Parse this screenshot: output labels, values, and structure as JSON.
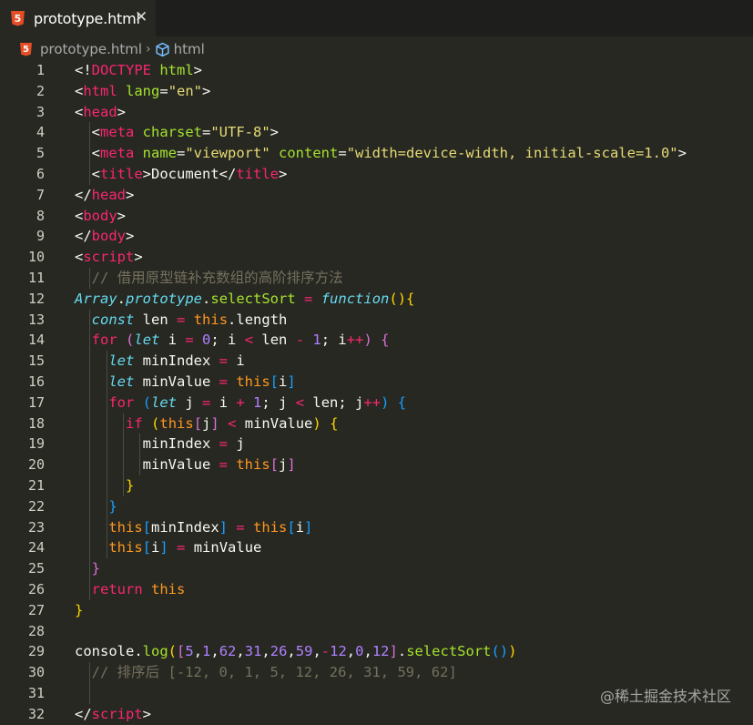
{
  "tab": {
    "file_icon": "html5-icon",
    "label": "prototype.html",
    "close_icon": "close-icon",
    "close_glyph": "✕"
  },
  "breadcrumb": {
    "file_icon": "html5-icon",
    "file": "prototype.html",
    "separator": "›",
    "symbol_icon": "cube-icon",
    "symbol": "html"
  },
  "editor": {
    "lines": [
      [
        {
          "t": "<!",
          "c": "p"
        },
        {
          "t": "DOCTYPE",
          "c": "k"
        },
        {
          "t": " ",
          "c": "p"
        },
        {
          "t": "html",
          "c": "a"
        },
        {
          "t": ">",
          "c": "p"
        }
      ],
      [
        {
          "t": "<",
          "c": "p"
        },
        {
          "t": "html",
          "c": "k"
        },
        {
          "t": " ",
          "c": "p"
        },
        {
          "t": "lang",
          "c": "a"
        },
        {
          "t": "=",
          "c": "p"
        },
        {
          "t": "\"en\"",
          "c": "s"
        },
        {
          "t": ">",
          "c": "p"
        }
      ],
      [
        {
          "t": "<",
          "c": "p"
        },
        {
          "t": "head",
          "c": "k"
        },
        {
          "t": ">",
          "c": "p"
        }
      ],
      [
        {
          "t": "  <",
          "c": "p"
        },
        {
          "t": "meta",
          "c": "k"
        },
        {
          "t": " ",
          "c": "p"
        },
        {
          "t": "charset",
          "c": "a"
        },
        {
          "t": "=",
          "c": "p"
        },
        {
          "t": "\"UTF-8\"",
          "c": "s"
        },
        {
          "t": ">",
          "c": "p"
        }
      ],
      [
        {
          "t": "  <",
          "c": "p"
        },
        {
          "t": "meta",
          "c": "k"
        },
        {
          "t": " ",
          "c": "p"
        },
        {
          "t": "name",
          "c": "a"
        },
        {
          "t": "=",
          "c": "p"
        },
        {
          "t": "\"viewport\"",
          "c": "s"
        },
        {
          "t": " ",
          "c": "p"
        },
        {
          "t": "content",
          "c": "a"
        },
        {
          "t": "=",
          "c": "p"
        },
        {
          "t": "\"width=device-width, initial-scale=1.0\"",
          "c": "s"
        },
        {
          "t": ">",
          "c": "p"
        }
      ],
      [
        {
          "t": "  <",
          "c": "p"
        },
        {
          "t": "title",
          "c": "k"
        },
        {
          "t": ">Document</",
          "c": "p"
        },
        {
          "t": "title",
          "c": "k"
        },
        {
          "t": ">",
          "c": "p"
        }
      ],
      [
        {
          "t": "</",
          "c": "p"
        },
        {
          "t": "head",
          "c": "k"
        },
        {
          "t": ">",
          "c": "p"
        }
      ],
      [
        {
          "t": "<",
          "c": "p"
        },
        {
          "t": "body",
          "c": "k"
        },
        {
          "t": ">",
          "c": "p"
        }
      ],
      [
        {
          "t": "</",
          "c": "p"
        },
        {
          "t": "body",
          "c": "k"
        },
        {
          "t": ">",
          "c": "p"
        }
      ],
      [
        {
          "t": "<",
          "c": "p"
        },
        {
          "t": "script",
          "c": "k"
        },
        {
          "t": ">",
          "c": "p"
        }
      ],
      [
        {
          "t": "  // 借用原型链补充数组的高阶排序方法",
          "c": "c"
        }
      ],
      [
        {
          "t": "Array",
          "c": "kw"
        },
        {
          "t": ".",
          "c": "p"
        },
        {
          "t": "prototype",
          "c": "kw"
        },
        {
          "t": ".",
          "c": "p"
        },
        {
          "t": "selectSort",
          "c": "a"
        },
        {
          "t": " ",
          "c": "p"
        },
        {
          "t": "=",
          "c": "k"
        },
        {
          "t": " ",
          "c": "p"
        },
        {
          "t": "function",
          "c": "kw"
        },
        {
          "t": "(){",
          "c": "by"
        }
      ],
      [
        {
          "t": "  ",
          "c": "p"
        },
        {
          "t": "const",
          "c": "kw"
        },
        {
          "t": " len ",
          "c": "p"
        },
        {
          "t": "=",
          "c": "k"
        },
        {
          "t": " ",
          "c": "p"
        },
        {
          "t": "this",
          "c": "kt"
        },
        {
          "t": ".length",
          "c": "p"
        }
      ],
      [
        {
          "t": "  ",
          "c": "p"
        },
        {
          "t": "for",
          "c": "k"
        },
        {
          "t": " ",
          "c": "p"
        },
        {
          "t": "(",
          "c": "bp"
        },
        {
          "t": "let",
          "c": "kw"
        },
        {
          "t": " i ",
          "c": "p"
        },
        {
          "t": "=",
          "c": "k"
        },
        {
          "t": " ",
          "c": "p"
        },
        {
          "t": "0",
          "c": "n"
        },
        {
          "t": "; i ",
          "c": "p"
        },
        {
          "t": "<",
          "c": "k"
        },
        {
          "t": " len ",
          "c": "p"
        },
        {
          "t": "-",
          "c": "k"
        },
        {
          "t": " ",
          "c": "p"
        },
        {
          "t": "1",
          "c": "n"
        },
        {
          "t": "; i",
          "c": "p"
        },
        {
          "t": "++",
          "c": "k"
        },
        {
          "t": ")",
          "c": "bp"
        },
        {
          "t": " ",
          "c": "p"
        },
        {
          "t": "{",
          "c": "bp"
        }
      ],
      [
        {
          "t": "    ",
          "c": "p"
        },
        {
          "t": "let",
          "c": "kw"
        },
        {
          "t": " minIndex ",
          "c": "p"
        },
        {
          "t": "=",
          "c": "k"
        },
        {
          "t": " i",
          "c": "p"
        }
      ],
      [
        {
          "t": "    ",
          "c": "p"
        },
        {
          "t": "let",
          "c": "kw"
        },
        {
          "t": " minValue ",
          "c": "p"
        },
        {
          "t": "=",
          "c": "k"
        },
        {
          "t": " ",
          "c": "p"
        },
        {
          "t": "this",
          "c": "kt"
        },
        {
          "t": "[",
          "c": "bb"
        },
        {
          "t": "i",
          "c": "p"
        },
        {
          "t": "]",
          "c": "bb"
        }
      ],
      [
        {
          "t": "    ",
          "c": "p"
        },
        {
          "t": "for",
          "c": "k"
        },
        {
          "t": " ",
          "c": "p"
        },
        {
          "t": "(",
          "c": "bb"
        },
        {
          "t": "let",
          "c": "kw"
        },
        {
          "t": " j ",
          "c": "p"
        },
        {
          "t": "=",
          "c": "k"
        },
        {
          "t": " i ",
          "c": "p"
        },
        {
          "t": "+",
          "c": "k"
        },
        {
          "t": " ",
          "c": "p"
        },
        {
          "t": "1",
          "c": "n"
        },
        {
          "t": "; j ",
          "c": "p"
        },
        {
          "t": "<",
          "c": "k"
        },
        {
          "t": " len; j",
          "c": "p"
        },
        {
          "t": "++",
          "c": "k"
        },
        {
          "t": ")",
          "c": "bb"
        },
        {
          "t": " ",
          "c": "p"
        },
        {
          "t": "{",
          "c": "bb"
        }
      ],
      [
        {
          "t": "      ",
          "c": "p"
        },
        {
          "t": "if",
          "c": "k"
        },
        {
          "t": " ",
          "c": "p"
        },
        {
          "t": "(",
          "c": "by"
        },
        {
          "t": "this",
          "c": "kt"
        },
        {
          "t": "[",
          "c": "bp"
        },
        {
          "t": "j",
          "c": "p"
        },
        {
          "t": "]",
          "c": "bp"
        },
        {
          "t": " ",
          "c": "p"
        },
        {
          "t": "<",
          "c": "k"
        },
        {
          "t": " minValue",
          "c": "p"
        },
        {
          "t": ")",
          "c": "by"
        },
        {
          "t": " ",
          "c": "p"
        },
        {
          "t": "{",
          "c": "by"
        }
      ],
      [
        {
          "t": "        minIndex ",
          "c": "p"
        },
        {
          "t": "=",
          "c": "k"
        },
        {
          "t": " j",
          "c": "p"
        }
      ],
      [
        {
          "t": "        minValue ",
          "c": "p"
        },
        {
          "t": "=",
          "c": "k"
        },
        {
          "t": " ",
          "c": "p"
        },
        {
          "t": "this",
          "c": "kt"
        },
        {
          "t": "[",
          "c": "bp"
        },
        {
          "t": "j",
          "c": "p"
        },
        {
          "t": "]",
          "c": "bp"
        }
      ],
      [
        {
          "t": "      ",
          "c": "p"
        },
        {
          "t": "}",
          "c": "by"
        }
      ],
      [
        {
          "t": "    ",
          "c": "p"
        },
        {
          "t": "}",
          "c": "bb"
        }
      ],
      [
        {
          "t": "    ",
          "c": "p"
        },
        {
          "t": "this",
          "c": "kt"
        },
        {
          "t": "[",
          "c": "bb"
        },
        {
          "t": "minIndex",
          "c": "p"
        },
        {
          "t": "]",
          "c": "bb"
        },
        {
          "t": " ",
          "c": "p"
        },
        {
          "t": "=",
          "c": "k"
        },
        {
          "t": " ",
          "c": "p"
        },
        {
          "t": "this",
          "c": "kt"
        },
        {
          "t": "[",
          "c": "bb"
        },
        {
          "t": "i",
          "c": "p"
        },
        {
          "t": "]",
          "c": "bb"
        }
      ],
      [
        {
          "t": "    ",
          "c": "p"
        },
        {
          "t": "this",
          "c": "kt"
        },
        {
          "t": "[",
          "c": "bb"
        },
        {
          "t": "i",
          "c": "p"
        },
        {
          "t": "]",
          "c": "bb"
        },
        {
          "t": " ",
          "c": "p"
        },
        {
          "t": "=",
          "c": "k"
        },
        {
          "t": " minValue",
          "c": "p"
        }
      ],
      [
        {
          "t": "  ",
          "c": "p"
        },
        {
          "t": "}",
          "c": "bp"
        }
      ],
      [
        {
          "t": "  ",
          "c": "p"
        },
        {
          "t": "return",
          "c": "k"
        },
        {
          "t": " ",
          "c": "p"
        },
        {
          "t": "this",
          "c": "kt"
        }
      ],
      [
        {
          "t": "}",
          "c": "by"
        }
      ],
      [],
      [
        {
          "t": "console.",
          "c": "p"
        },
        {
          "t": "log",
          "c": "a"
        },
        {
          "t": "(",
          "c": "by"
        },
        {
          "t": "[",
          "c": "bp"
        },
        {
          "t": "5",
          "c": "n"
        },
        {
          "t": ",",
          "c": "p"
        },
        {
          "t": "1",
          "c": "n"
        },
        {
          "t": ",",
          "c": "p"
        },
        {
          "t": "62",
          "c": "n"
        },
        {
          "t": ",",
          "c": "p"
        },
        {
          "t": "31",
          "c": "n"
        },
        {
          "t": ",",
          "c": "p"
        },
        {
          "t": "26",
          "c": "n"
        },
        {
          "t": ",",
          "c": "p"
        },
        {
          "t": "59",
          "c": "n"
        },
        {
          "t": ",",
          "c": "p"
        },
        {
          "t": "-",
          "c": "k"
        },
        {
          "t": "12",
          "c": "n"
        },
        {
          "t": ",",
          "c": "p"
        },
        {
          "t": "0",
          "c": "n"
        },
        {
          "t": ",",
          "c": "p"
        },
        {
          "t": "12",
          "c": "n"
        },
        {
          "t": "]",
          "c": "bp"
        },
        {
          "t": ".",
          "c": "p"
        },
        {
          "t": "selectSort",
          "c": "a"
        },
        {
          "t": "()",
          "c": "bb"
        },
        {
          "t": ")",
          "c": "by"
        }
      ],
      [
        {
          "t": "  // 排序后 [-12, 0, 1, 5, 12, 26, 31, 59, 62]",
          "c": "c"
        }
      ],
      [],
      [
        {
          "t": "</",
          "c": "p"
        },
        {
          "t": "script",
          "c": "k"
        },
        {
          "t": ">",
          "c": "p"
        }
      ]
    ],
    "indent_guides": [
      [],
      [],
      [],
      [
        2
      ],
      [
        2
      ],
      [
        2
      ],
      [],
      [],
      [],
      [],
      [
        2
      ],
      [],
      [
        2
      ],
      [
        2
      ],
      [
        2,
        4
      ],
      [
        2,
        4
      ],
      [
        2,
        4
      ],
      [
        2,
        4,
        6
      ],
      [
        2,
        4,
        6,
        8
      ],
      [
        2,
        4,
        6,
        8
      ],
      [
        2,
        4,
        6
      ],
      [
        2,
        4
      ],
      [
        2,
        4
      ],
      [
        2,
        4
      ],
      [
        2
      ],
      [
        2
      ],
      [],
      [],
      [],
      [
        2
      ],
      [
        2
      ],
      []
    ]
  },
  "watermark": "@稀土掘金技术社区",
  "colors": {
    "background": "#272822",
    "tabbar": "#1e1f1c",
    "keyword": "#f92672",
    "storage": "#66d9ef",
    "string": "#e6db74",
    "number": "#ae81ff",
    "attribute": "#a6e22e",
    "comment": "#75715e",
    "text": "#f8f8f2"
  }
}
